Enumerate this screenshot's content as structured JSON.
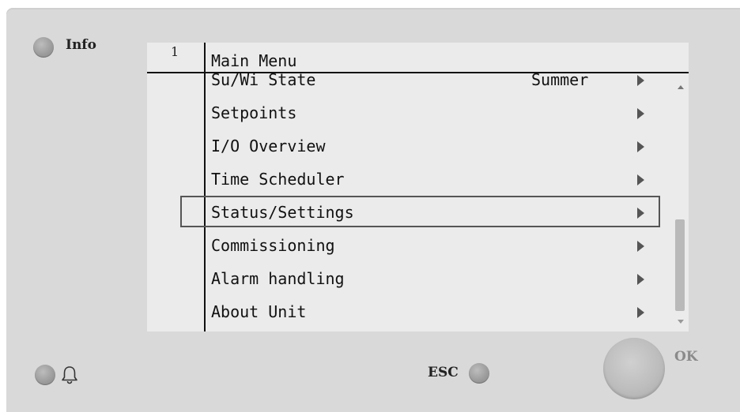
{
  "panel": {
    "info_label": "Info",
    "esc_label": "ESC",
    "ok_label": "OK",
    "icons": [
      "bell-icon"
    ]
  },
  "screen": {
    "page_number": "1",
    "title": "Main Menu",
    "items": [
      {
        "label": "Su/Wi State",
        "value": "Summer"
      },
      {
        "label": "Setpoints",
        "value": ""
      },
      {
        "label": "I/O Overview",
        "value": ""
      },
      {
        "label": "Time Scheduler",
        "value": ""
      },
      {
        "label": "Status/Settings",
        "value": ""
      },
      {
        "label": "Commissioning",
        "value": ""
      },
      {
        "label": "Alarm handling",
        "value": ""
      },
      {
        "label": "About Unit",
        "value": ""
      }
    ],
    "selected_index": 4,
    "colors": {
      "screen_bg": "#ebebeb",
      "panel_bg": "#d9d9d9",
      "text": "#111111",
      "selection_border": "#555555"
    }
  }
}
